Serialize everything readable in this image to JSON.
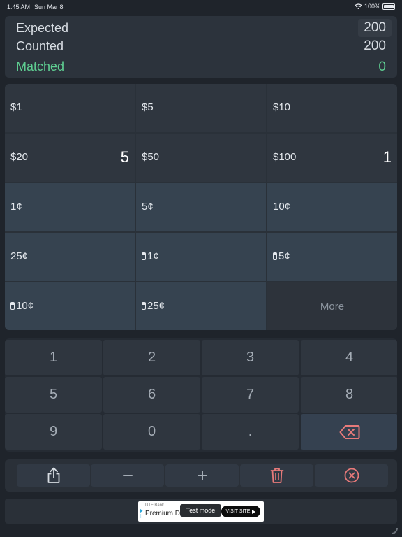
{
  "status_bar": {
    "time": "1:45 AM",
    "date": "Sun Mar 8",
    "battery": "100%",
    "battery_level": 1.0
  },
  "summary": {
    "expected_label": "Expected",
    "expected_value": "200",
    "counted_label": "Counted",
    "counted_value": "200",
    "matched_label": "Matched",
    "matched_value": "0",
    "matched_color": "#5fcf92"
  },
  "denominations": [
    {
      "label": "$1",
      "count": "",
      "roll": false
    },
    {
      "label": "$5",
      "count": "",
      "roll": false
    },
    {
      "label": "$10",
      "count": "",
      "roll": false
    },
    {
      "label": "$20",
      "count": "5",
      "roll": false
    },
    {
      "label": "$50",
      "count": "",
      "roll": false
    },
    {
      "label": "$100",
      "count": "1",
      "roll": false
    },
    {
      "label": "1¢",
      "count": "",
      "roll": false
    },
    {
      "label": "5¢",
      "count": "",
      "roll": false
    },
    {
      "label": "10¢",
      "count": "",
      "roll": false
    },
    {
      "label": "25¢",
      "count": "",
      "roll": false
    },
    {
      "label": "1¢",
      "count": "",
      "roll": true
    },
    {
      "label": "5¢",
      "count": "",
      "roll": true
    },
    {
      "label": "10¢",
      "count": "",
      "roll": true
    },
    {
      "label": "25¢",
      "count": "",
      "roll": true
    },
    {
      "label": "More",
      "count": "",
      "roll": false
    }
  ],
  "keypad": [
    "1",
    "2",
    "3",
    "4",
    "5",
    "6",
    "7",
    "8",
    "9",
    "0",
    "."
  ],
  "toolbar": {
    "icons": [
      "share-icon",
      "minus-icon",
      "plus-icon",
      "trash-icon",
      "clear-circle-icon"
    ],
    "accent_color": "#e87a7a"
  },
  "ad": {
    "bank": "DTF Bank",
    "title": "Premium D",
    "test_mode": "Test mode",
    "visit": "VISIT SITE"
  }
}
